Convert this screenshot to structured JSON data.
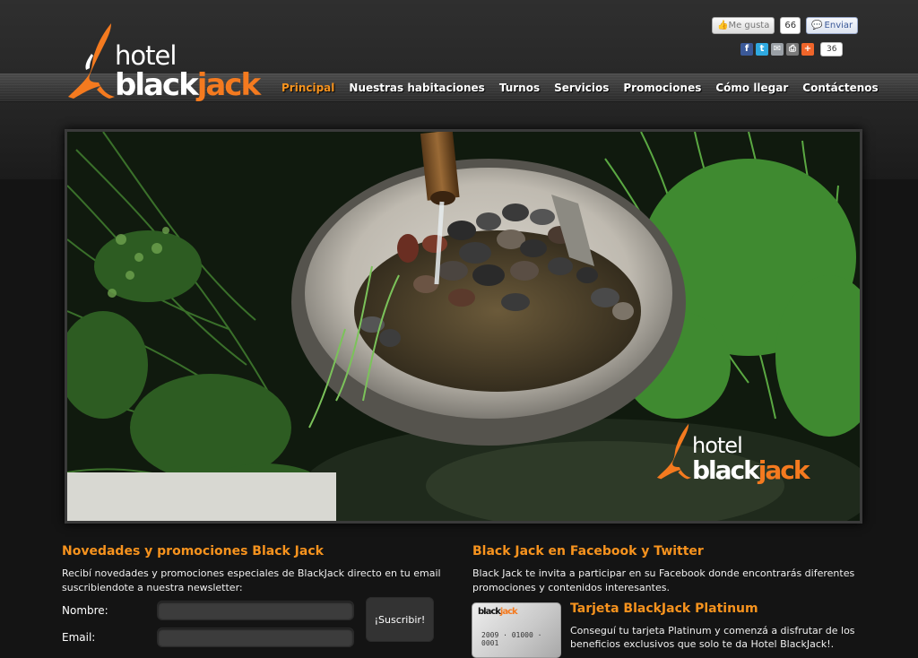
{
  "brand": {
    "logo_hotel": "hotel",
    "logo_black": "black",
    "logo_jack": "jack",
    "accent_color": "#f47a1f"
  },
  "social": {
    "like_label": "Me gusta",
    "like_count": "66",
    "send_label": "Enviar",
    "share_count": "36",
    "share_icons": [
      "facebook-icon",
      "twitter-icon",
      "email-icon",
      "print-icon",
      "plus-share-icon"
    ]
  },
  "nav": {
    "items": [
      "Principal",
      "Nuestras habitaciones",
      "Turnos",
      "Servicios",
      "Promociones",
      "Cómo llegar",
      "Contáctenos"
    ],
    "active_index": 0
  },
  "hero": {
    "logo_hotel": "hotel",
    "logo_black": "black",
    "logo_jack": "jack"
  },
  "newsletter": {
    "title": "Novedades y promociones Black Jack",
    "text": "Recibí novedades y promociones especiales de BlackJack directo en tu email suscribiendote a nuestra newsletter:",
    "name_label": "Nombre:",
    "email_label": "Email:",
    "name_value": "",
    "email_value": "",
    "submit_label": "¡Suscribir!"
  },
  "facebook": {
    "title": "Black Jack en Facebook y Twitter",
    "text": "Black Jack te invita a participar en su Facebook donde encontrarás diferentes promociones y contenidos interesantes."
  },
  "platinum": {
    "title": "Tarjeta BlackJack Platinum",
    "text": "Conseguí tu tarjeta Platinum y comenzá a disfrutar de los beneficios exclusivos que solo te da Hotel BlackJack!.",
    "card_brand_black": "black",
    "card_brand_jack": "jack",
    "card_number": "2009 · 01000 · 0001"
  }
}
